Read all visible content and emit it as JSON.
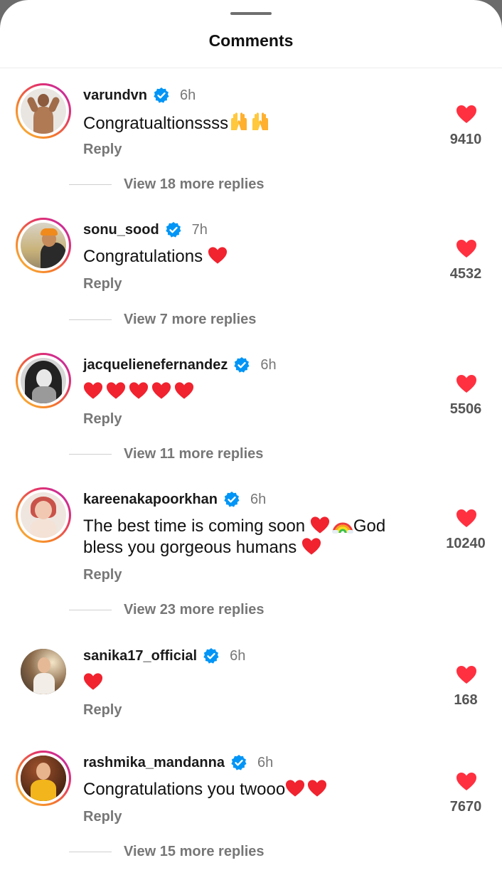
{
  "sheet": {
    "title": "Comments"
  },
  "comments": [
    {
      "username": "varundvn",
      "time": "6h",
      "text": "Congratualtionssss",
      "text_emoji": [
        "raised-hands",
        "raised-hands"
      ],
      "reply_label": "Reply",
      "likes": "9410",
      "view_replies": "View 18 more replies",
      "story_ring": true
    },
    {
      "username": "sonu_sood",
      "time": "7h",
      "text": "Congratulations ",
      "text_emoji": [
        "red-heart"
      ],
      "reply_label": "Reply",
      "likes": "4532",
      "view_replies": "View 7 more replies",
      "story_ring": true
    },
    {
      "username": "jacquelienefernandez",
      "time": "6h",
      "text": "",
      "text_emoji": [
        "red-heart",
        "red-heart",
        "red-heart",
        "red-heart",
        "red-heart"
      ],
      "reply_label": "Reply",
      "likes": "5506",
      "view_replies": "View 11 more replies",
      "story_ring": true
    },
    {
      "username": "kareenakapoorkhan",
      "time": "6h",
      "text_line1": "The best time is coming soon ",
      "text_line1_mid": "God",
      "text_line2": "bless you gorgeous humans ",
      "text_emoji": [
        "red-heart",
        "rainbow",
        "red-heart"
      ],
      "reply_label": "Reply",
      "likes": "10240",
      "view_replies": "View 23 more replies",
      "story_ring": true
    },
    {
      "username": "sanika17_official",
      "time": "6h",
      "text": "",
      "text_emoji": [
        "red-heart"
      ],
      "reply_label": "Reply",
      "likes": "168",
      "story_ring": false
    },
    {
      "username": "rashmika_mandanna",
      "time": "6h",
      "text": "Congratulations you twooo",
      "text_emoji": [
        "red-heart",
        "red-heart"
      ],
      "reply_label": "Reply",
      "likes": "7670",
      "view_replies": "View 15 more replies",
      "story_ring": true
    }
  ],
  "colors": {
    "like_red": "#ff3040",
    "verified_blue": "#0095f6",
    "muted_text": "#777777"
  },
  "icons": {
    "like": "heart-icon",
    "verified": "verified-badge-icon"
  }
}
